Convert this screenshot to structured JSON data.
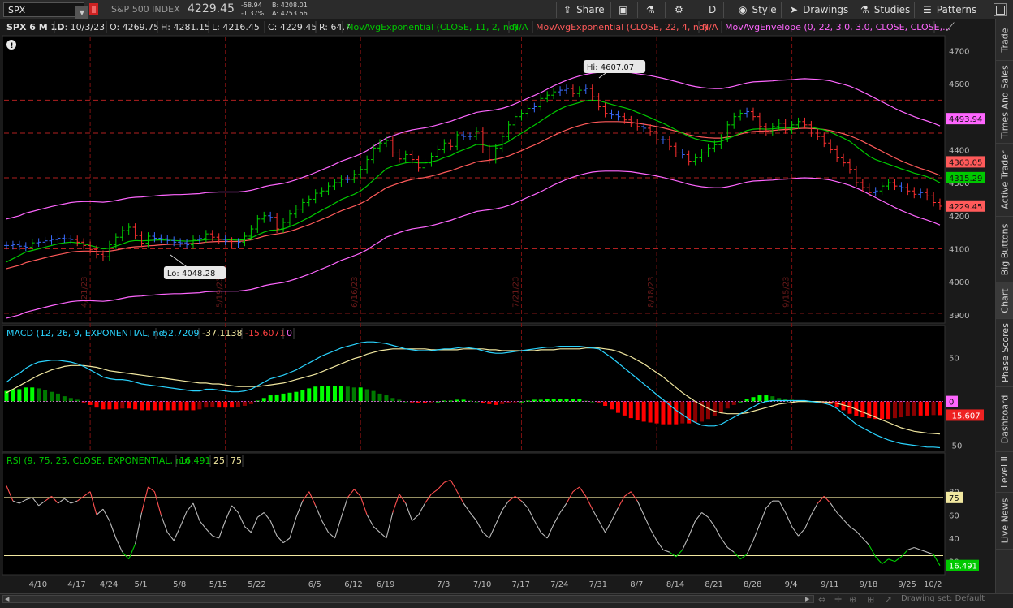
{
  "toolbar": {
    "symbol": "SPX",
    "index_name": "S&P 500 INDEX",
    "last": "4229.45",
    "change": "-58.94",
    "change_pct": "-1.37%",
    "bid": "B: 4208.01",
    "ask": "A: 4253.66",
    "share_label": "Share",
    "aggregation_label": "D",
    "style_label": "Style",
    "drawings_label": "Drawings",
    "studies_label": "Studies",
    "patterns_label": "Patterns"
  },
  "header": {
    "chart_label": "SPX 6 M 1D",
    "date": "D: 10/3/23",
    "open": "O: 4269.75",
    "high": "H: 4281.15",
    "low": "L: 4216.45",
    "close": "C: 4229.45",
    "range": "R: 64.7",
    "ema1_label": "MovAvgExponential (CLOSE, 11, 2, no)",
    "ema1_value": "N/A",
    "ema2_label": "MovAvgExponential (CLOSE, 22, 4, no)",
    "ema2_value": "N/A",
    "env_label": "MovAvgEnvelope (0, 22, 3.0, 3.0, CLOSE, CLOSE,...",
    "macd_label": "MACD (12, 26, 9, EXPONENTIAL, no)",
    "macd_value": "-52.7209",
    "macd_avg": "-37.1138",
    "macd_diff": "-15.6071",
    "macd_zero": "0",
    "rsi_label": "RSI (9, 75, 25, CLOSE, EXPONENTIAL, no)",
    "rsi_value": "16.491",
    "rsi_os": "25",
    "rsi_ob": "75"
  },
  "sidebar": {
    "tabs": [
      "Trade",
      "Times And Sales",
      "Active Trader",
      "Big Buttons",
      "Chart",
      "Phase Scores",
      "Dashboard",
      "Level II",
      "Live News"
    ]
  },
  "footer": {
    "drawing_set": "Drawing set: Default"
  },
  "colors": {
    "background": "#1a1a1a",
    "up_bar": "#00d000",
    "down_bar": "#ff3030",
    "neutral_bar": "#3a6cff",
    "ema_fast": "#00c800",
    "ema_slow": "#ff5a5a",
    "envelope": "#ff66ff",
    "macd_line": "#2ad4ff",
    "macd_avg": "#f2e8a0",
    "rsi_line": "#bbbbbb",
    "rsi_ob_line": "#f2e8a0"
  },
  "chart_data": [
    {
      "type": "ohlc",
      "name": "price",
      "x_labels": [
        "4/10",
        "4/17",
        "4/24",
        "5/1",
        "5/8",
        "5/15",
        "5/22",
        "6/5",
        "6/12",
        "6/19",
        "7/3",
        "7/10",
        "7/17",
        "7/24",
        "7/31",
        "8/7",
        "8/14",
        "8/21",
        "8/28",
        "9/4",
        "9/11",
        "9/18",
        "9/25",
        "10/2"
      ],
      "vertical_marker_dates": [
        "4/21/23",
        "5/19/23",
        "6/16/23",
        "7/21/23",
        "8/18/23",
        "9/15/23"
      ],
      "ylim": [
        3880,
        4740
      ],
      "y_ticks": [
        3900,
        4000,
        4100,
        4200,
        4300,
        4400,
        4500,
        4600,
        4700
      ],
      "hi_label": "Hi: 4607.07",
      "lo_label": "Lo: 4048.28",
      "hline_levels": [
        4550,
        4450,
        4315,
        4100,
        3905
      ],
      "price_labels": [
        {
          "text": "4493.94",
          "value": 4493.94,
          "color": "#ff66ff"
        },
        {
          "text": "4363.05",
          "value": 4363.05,
          "color": "#ff5a5a"
        },
        {
          "text": "4315.29",
          "value": 4315.29,
          "color": "#00c800"
        },
        {
          "text": "4229.45",
          "value": 4229.45,
          "color": "#ff5a5a"
        }
      ],
      "closes": [
        4110,
        4112,
        4108,
        4105,
        4118,
        4120,
        4124,
        4128,
        4132,
        4130,
        4128,
        4120,
        4110,
        4098,
        4083,
        4076,
        4112,
        4135,
        4155,
        4165,
        4140,
        4117,
        4138,
        4132,
        4130,
        4125,
        4120,
        4118,
        4112,
        4128,
        4131,
        4145,
        4135,
        4128,
        4123,
        4115,
        4120,
        4138,
        4160,
        4190,
        4200,
        4195,
        4160,
        4180,
        4205,
        4220,
        4240,
        4250,
        4268,
        4275,
        4290,
        4300,
        4310,
        4310,
        4325,
        4340,
        4370,
        4405,
        4420,
        4428,
        4390,
        4372,
        4385,
        4370,
        4345,
        4360,
        4380,
        4400,
        4420,
        4410,
        4445,
        4440,
        4440,
        4455,
        4402,
        4370,
        4405,
        4440,
        4475,
        4500,
        4510,
        4525,
        4530,
        4555,
        4565,
        4575,
        4580,
        4585,
        4570,
        4580,
        4585,
        4560,
        4530,
        4510,
        4505,
        4500,
        4490,
        4480,
        4470,
        4465,
        4455,
        4430,
        4430,
        4410,
        4390,
        4385,
        4365,
        4375,
        4390,
        4405,
        4415,
        4435,
        4475,
        4500,
        4510,
        4515,
        4500,
        4470,
        4455,
        4470,
        4480,
        4460,
        4475,
        4485,
        4475,
        4450,
        4440,
        4420,
        4400,
        4375,
        4360,
        4340,
        4300,
        4285,
        4270,
        4275,
        4290,
        4300,
        4290,
        4285,
        4275,
        4265,
        4270,
        4260,
        4240,
        4229
      ],
      "ema_fast": [
        4060,
        4070,
        4080,
        4090,
        4095,
        4100,
        4105,
        4110,
        4115,
        4118,
        4120,
        4118,
        4115,
        4110,
        4105,
        4100,
        4102,
        4108,
        4115,
        4122,
        4125,
        4124,
        4125,
        4126,
        4127,
        4126,
        4125,
        4124,
        4123,
        4124,
        4125,
        4128,
        4129,
        4129,
        4128,
        4127,
        4126,
        4128,
        4133,
        4142,
        4150,
        4156,
        4157,
        4160,
        4167,
        4175,
        4185,
        4195,
        4206,
        4217,
        4227,
        4238,
        4249,
        4257,
        4265,
        4275,
        4290,
        4308,
        4325,
        4342,
        4350,
        4355,
        4360,
        4362,
        4360,
        4360,
        4363,
        4368,
        4376,
        4382,
        4392,
        4400,
        4407,
        4416,
        4415,
        4410,
        4411,
        4415,
        4425,
        4438,
        4450,
        4462,
        4474,
        4487,
        4500,
        4512,
        4523,
        4532,
        4537,
        4543,
        4548,
        4550,
        4548,
        4543,
        4537,
        4532,
        4527,
        4521,
        4513,
        4505,
        4497,
        4488,
        4480,
        4470,
        4460,
        4450,
        4440,
        4433,
        4428,
        4425,
        4423,
        4425,
        4433,
        4441,
        4450,
        4458,
        4462,
        4463,
        4462,
        4463,
        4465,
        4465,
        4466,
        4468,
        4469,
        4468,
        4464,
        4460,
        4453,
        4444,
        4435,
        4425,
        4410,
        4395,
        4380,
        4370,
        4363,
        4356,
        4349,
        4342,
        4336,
        4329,
        4324,
        4318,
        4310,
        4300
      ],
      "ema_slow": [
        4040,
        4045,
        4050,
        4058,
        4063,
        4068,
        4073,
        4078,
        4082,
        4086,
        4090,
        4092,
        4093,
        4093,
        4092,
        4091,
        4093,
        4096,
        4100,
        4104,
        4106,
        4107,
        4109,
        4110,
        4112,
        4113,
        4114,
        4114,
        4115,
        4116,
        4117,
        4120,
        4121,
        4122,
        4122,
        4122,
        4122,
        4124,
        4127,
        4132,
        4138,
        4142,
        4145,
        4148,
        4153,
        4159,
        4166,
        4173,
        4181,
        4189,
        4197,
        4206,
        4215,
        4222,
        4229,
        4237,
        4247,
        4260,
        4272,
        4285,
        4292,
        4299,
        4305,
        4310,
        4313,
        4316,
        4320,
        4325,
        4331,
        4336,
        4343,
        4350,
        4356,
        4363,
        4366,
        4368,
        4371,
        4375,
        4381,
        4389,
        4397,
        4406,
        4414,
        4423,
        4433,
        4443,
        4452,
        4460,
        4467,
        4473,
        4478,
        4482,
        4484,
        4485,
        4485,
        4485,
        4484,
        4483,
        4480,
        4477,
        4474,
        4470,
        4466,
        4461,
        4456,
        4451,
        4445,
        4441,
        4438,
        4436,
        4435,
        4435,
        4438,
        4442,
        4447,
        4452,
        4455,
        4456,
        4457,
        4458,
        4460,
        4461,
        4462,
        4464,
        4465,
        4464,
        4463,
        4461,
        4458,
        4453,
        4448,
        4442,
        4434,
        4425,
        4415,
        4405,
        4395,
        4385,
        4375,
        4366,
        4358,
        4350,
        4343,
        4337,
        4330,
        4322
      ],
      "envelope_upper": [
        4190,
        4195,
        4200,
        4208,
        4213,
        4218,
        4223,
        4228,
        4232,
        4236,
        4240,
        4242,
        4243,
        4243,
        4242,
        4241,
        4243,
        4246,
        4250,
        4254,
        4256,
        4257,
        4259,
        4260,
        4262,
        4263,
        4264,
        4264,
        4265,
        4266,
        4267,
        4270,
        4271,
        4272,
        4272,
        4272,
        4272,
        4274,
        4277,
        4282,
        4288,
        4292,
        4295,
        4298,
        4303,
        4309,
        4316,
        4323,
        4331,
        4339,
        4347,
        4356,
        4365,
        4372,
        4379,
        4387,
        4397,
        4410,
        4422,
        4435,
        4442,
        4449,
        4455,
        4460,
        4463,
        4466,
        4470,
        4475,
        4481,
        4486,
        4493,
        4500,
        4506,
        4513,
        4516,
        4518,
        4521,
        4525,
        4531,
        4539,
        4547,
        4556,
        4564,
        4573,
        4583,
        4593,
        4602,
        4610,
        4617,
        4623,
        4628,
        4632,
        4634,
        4635,
        4635,
        4635,
        4634,
        4633,
        4630,
        4627,
        4624,
        4620,
        4616,
        4611,
        4606,
        4601,
        4595,
        4591,
        4588,
        4586,
        4585,
        4585,
        4588,
        4592,
        4597,
        4602,
        4605,
        4606,
        4607,
        4608,
        4610,
        4611,
        4612,
        4614,
        4615,
        4614,
        4613,
        4611,
        4608,
        4603,
        4598,
        4592,
        4584,
        4575,
        4565,
        4555,
        4545,
        4535,
        4525,
        4516,
        4508,
        4500,
        4493,
        4487,
        4480,
        4472
      ],
      "envelope_lower": [
        3890,
        3895,
        3900,
        3908,
        3913,
        3918,
        3923,
        3928,
        3932,
        3936,
        3940,
        3942,
        3943,
        3943,
        3942,
        3941,
        3943,
        3946,
        3950,
        3954,
        3956,
        3957,
        3959,
        3960,
        3962,
        3963,
        3964,
        3964,
        3965,
        3966,
        3967,
        3970,
        3971,
        3972,
        3972,
        3972,
        3972,
        3974,
        3977,
        3982,
        3988,
        3992,
        3995,
        3998,
        4003,
        4009,
        4016,
        4023,
        4031,
        4039,
        4047,
        4056,
        4065,
        4072,
        4079,
        4087,
        4097,
        4110,
        4122,
        4135,
        4142,
        4149,
        4155,
        4160,
        4163,
        4166,
        4170,
        4175,
        4181,
        4186,
        4193,
        4200,
        4206,
        4213,
        4216,
        4218,
        4221,
        4225,
        4231,
        4239,
        4247,
        4256,
        4264,
        4273,
        4283,
        4293,
        4302,
        4310,
        4317,
        4323,
        4328,
        4332,
        4334,
        4335,
        4335,
        4335,
        4334,
        4333,
        4330,
        4327,
        4324,
        4320,
        4316,
        4311,
        4306,
        4301,
        4295,
        4291,
        4288,
        4286,
        4285,
        4285,
        4288,
        4292,
        4297,
        4302,
        4305,
        4306,
        4307,
        4308,
        4310,
        4311,
        4312,
        4314,
        4315,
        4314,
        4313,
        4311,
        4308,
        4303,
        4298,
        4292,
        4284,
        4275,
        4265,
        4255,
        4245,
        4235,
        4225,
        4216,
        4208,
        4200,
        4193,
        4187,
        4180,
        4172
      ]
    },
    {
      "type": "macd",
      "name": "MACD",
      "ylim": [
        -55,
        70
      ],
      "y_ticks": [
        -50,
        0,
        50
      ],
      "macd_line": [
        22,
        28,
        32,
        38,
        42,
        45,
        46,
        47,
        47,
        46,
        45,
        43,
        40,
        36,
        32,
        28,
        26,
        25,
        25,
        24,
        22,
        20,
        19,
        18,
        17,
        16,
        15,
        14,
        13,
        12,
        12,
        14,
        14,
        13,
        12,
        11,
        11,
        12,
        14,
        18,
        22,
        26,
        28,
        30,
        33,
        36,
        40,
        44,
        48,
        52,
        55,
        58,
        61,
        63,
        65,
        67,
        68,
        68,
        67,
        66,
        64,
        62,
        60,
        59,
        58,
        58,
        58,
        59,
        60,
        60,
        61,
        62,
        61,
        60,
        58,
        56,
        55,
        55,
        56,
        57,
        58,
        59,
        60,
        61,
        62,
        62,
        63,
        63,
        63,
        63,
        62,
        61,
        60,
        55,
        50,
        44,
        38,
        32,
        26,
        20,
        14,
        8,
        2,
        -4,
        -10,
        -15,
        -20,
        -24,
        -27,
        -28,
        -28,
        -26,
        -22,
        -18,
        -14,
        -10,
        -6,
        -2,
        0,
        1,
        1,
        1,
        1,
        1,
        1,
        0,
        -1,
        -2,
        -4,
        -8,
        -14,
        -20,
        -26,
        -30,
        -34,
        -38,
        -41,
        -44,
        -46,
        -48,
        -49,
        -50,
        -51,
        -52,
        -52,
        -52.7
      ],
      "macd_avg": [
        10,
        14,
        18,
        22,
        26,
        30,
        33,
        36,
        38,
        40,
        41,
        41,
        41,
        40,
        39,
        37,
        35,
        34,
        33,
        32,
        31,
        30,
        29,
        28,
        27,
        26,
        25,
        24,
        23,
        22,
        21,
        21,
        20,
        20,
        19,
        18,
        17,
        17,
        17,
        17,
        18,
        19,
        20,
        21,
        23,
        25,
        27,
        29,
        31,
        34,
        37,
        40,
        43,
        46,
        49,
        51,
        54,
        56,
        58,
        59,
        60,
        60,
        60,
        60,
        60,
        60,
        59,
        59,
        59,
        59,
        59,
        60,
        60,
        60,
        60,
        59,
        59,
        58,
        58,
        58,
        58,
        58,
        58,
        59,
        59,
        59,
        60,
        60,
        60,
        60,
        61,
        61,
        61,
        60,
        59,
        57,
        54,
        51,
        47,
        43,
        38,
        33,
        28,
        22,
        16,
        10,
        5,
        0,
        -4,
        -8,
        -11,
        -13,
        -14,
        -14,
        -14,
        -13,
        -11,
        -9,
        -7,
        -5,
        -3,
        -2,
        -1,
        0,
        0,
        0,
        0,
        -0.5,
        -1,
        -2,
        -4,
        -6,
        -9,
        -12,
        -15,
        -18,
        -21,
        -24,
        -27,
        -30,
        -32,
        -34,
        -35,
        -36,
        -36.5,
        -37.1
      ]
    },
    {
      "type": "line",
      "name": "RSI",
      "ylim": [
        10,
        100
      ],
      "y_ticks": [
        20,
        40,
        60,
        80
      ],
      "overbought": 75,
      "oversold": 25,
      "value_label": "16.491",
      "values": [
        85,
        72,
        70,
        73,
        75,
        68,
        72,
        76,
        70,
        74,
        70,
        72,
        76,
        80,
        60,
        65,
        55,
        40,
        28,
        22,
        35,
        62,
        84,
        80,
        60,
        45,
        38,
        50,
        63,
        70,
        55,
        48,
        42,
        40,
        55,
        68,
        62,
        50,
        45,
        58,
        62,
        55,
        42,
        36,
        40,
        58,
        72,
        80,
        68,
        55,
        45,
        40,
        58,
        75,
        82,
        76,
        60,
        50,
        45,
        40,
        62,
        78,
        70,
        55,
        60,
        70,
        78,
        82,
        88,
        90,
        80,
        70,
        62,
        55,
        45,
        40,
        52,
        64,
        72,
        76,
        72,
        66,
        55,
        45,
        40,
        52,
        62,
        70,
        80,
        84,
        76,
        65,
        55,
        45,
        55,
        66,
        76,
        80,
        72,
        60,
        48,
        38,
        30,
        28,
        24,
        30,
        42,
        55,
        62,
        58,
        50,
        40,
        32,
        28,
        22,
        26,
        38,
        52,
        66,
        72,
        72,
        62,
        50,
        42,
        48,
        60,
        70,
        76,
        70,
        62,
        56,
        50,
        46,
        40,
        34,
        24,
        18,
        22,
        20,
        24,
        30,
        32,
        30,
        28,
        26,
        16.5
      ]
    }
  ]
}
